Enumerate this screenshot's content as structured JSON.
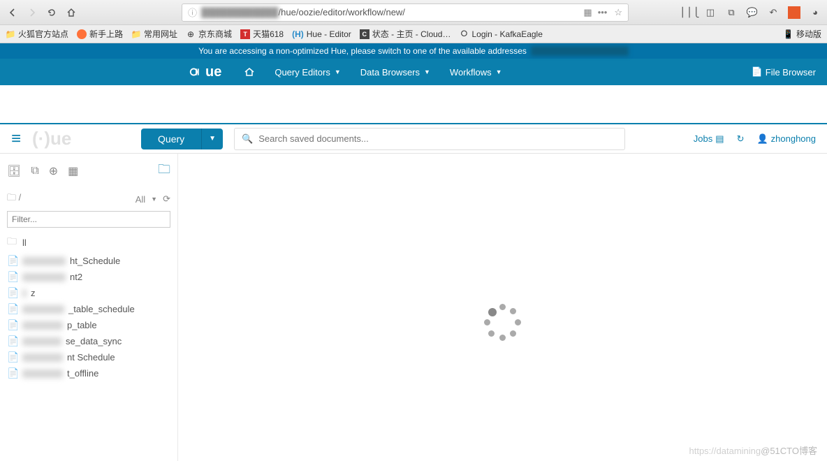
{
  "browser": {
    "url_visible": "/hue/oozie/editor/workflow/new/",
    "bookmarks": [
      {
        "icon": "folder",
        "label": "火狐官方站点"
      },
      {
        "icon": "firefox",
        "label": "新手上路"
      },
      {
        "icon": "folder",
        "label": "常用网址"
      },
      {
        "icon": "globe",
        "label": "京东商城"
      },
      {
        "icon": "t",
        "label": "天猫618"
      },
      {
        "icon": "h",
        "label": "Hue - Editor"
      },
      {
        "icon": "c",
        "label": "状态 - 主页 - Cloud…"
      },
      {
        "icon": "ring",
        "label": "Login - KafkaEagle"
      }
    ],
    "mobile_label": "移动版"
  },
  "notice": {
    "text": "You are accessing a non-optimized Hue, please switch to one of the available addresses"
  },
  "hue_nav": {
    "items": [
      "Query Editors",
      "Data Browsers",
      "Workflows"
    ],
    "file_browser": "File Browser"
  },
  "toolbar": {
    "query_label": "Query",
    "search_placeholder": "Search saved documents...",
    "jobs_label": "Jobs",
    "username": "zhonghong"
  },
  "sidebar": {
    "breadcrumb": "/",
    "filter_label": "All",
    "filter_placeholder": "Filter...",
    "docs": [
      {
        "icon": "folder",
        "prefix_w": 0,
        "suffix": "ll"
      },
      {
        "icon": "doc",
        "prefix_w": 62,
        "suffix": "ht_Schedule"
      },
      {
        "icon": "doc",
        "prefix_w": 62,
        "suffix": "nt2"
      },
      {
        "icon": "doc",
        "prefix_w": 6,
        "suffix": "z"
      },
      {
        "icon": "doc",
        "prefix_w": 60,
        "suffix": "_table_schedule"
      },
      {
        "icon": "doc",
        "prefix_w": 58,
        "suffix": "p_table"
      },
      {
        "icon": "doc",
        "prefix_w": 56,
        "suffix": "se_data_sync"
      },
      {
        "icon": "doc",
        "prefix_w": 58,
        "suffix": "nt Schedule"
      },
      {
        "icon": "doc",
        "prefix_w": 58,
        "suffix": "t_offline"
      }
    ]
  },
  "watermark": {
    "faint": "https://datamining",
    "dark": "@51CTO博客"
  }
}
